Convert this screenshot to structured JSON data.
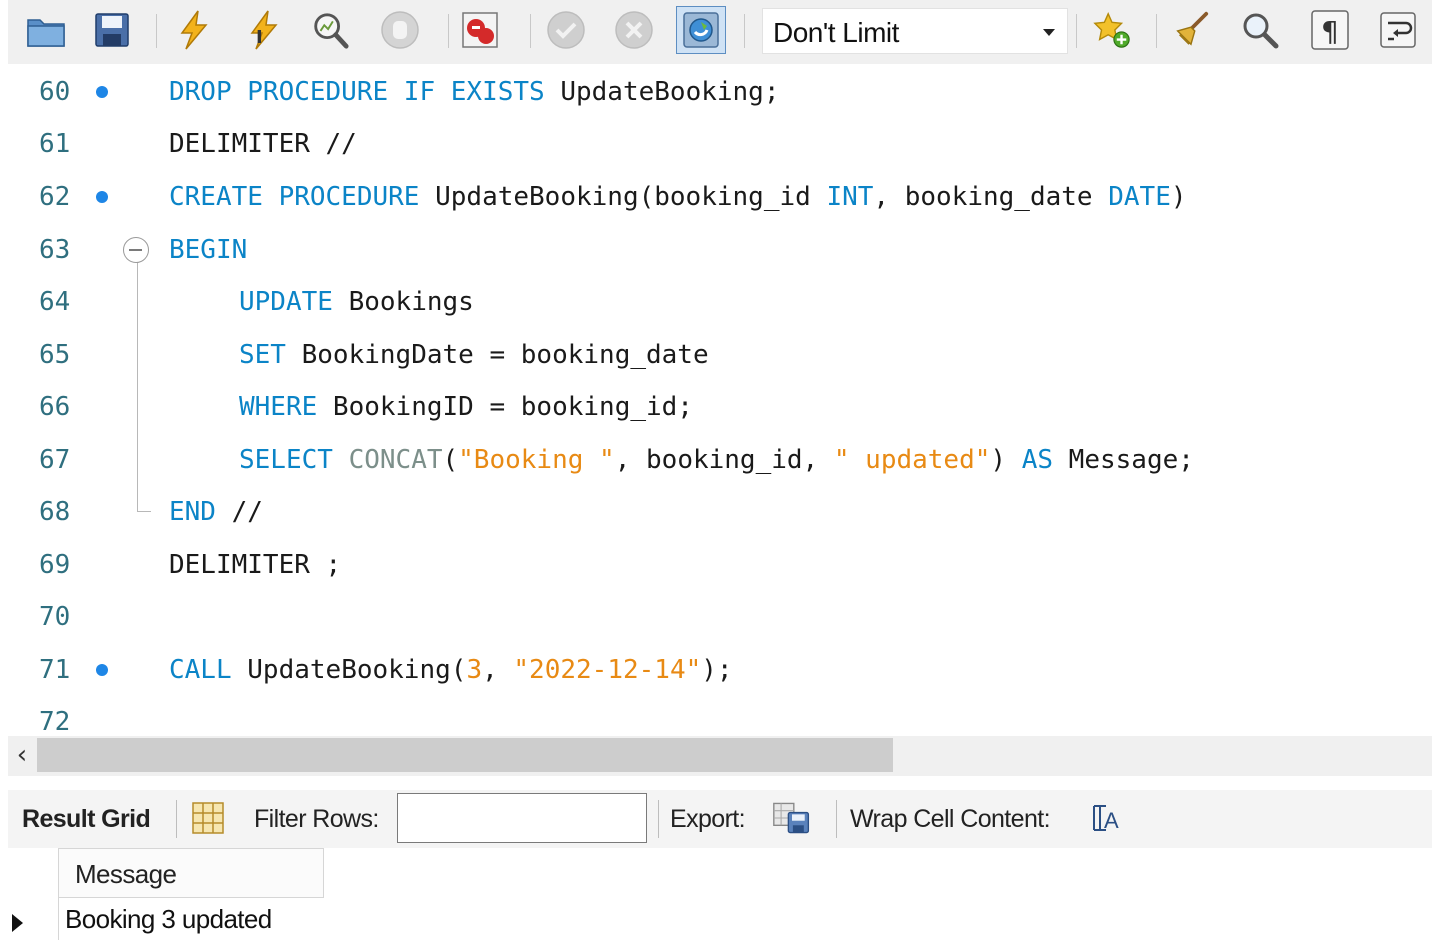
{
  "toolbar": {
    "limit_select": "Don't Limit"
  },
  "editor": {
    "lines": [
      {
        "num": "60",
        "dot": true
      },
      {
        "num": "61",
        "dot": false
      },
      {
        "num": "62",
        "dot": true
      },
      {
        "num": "63",
        "dot": false
      },
      {
        "num": "64",
        "dot": false
      },
      {
        "num": "65",
        "dot": false
      },
      {
        "num": "66",
        "dot": false
      },
      {
        "num": "67",
        "dot": false
      },
      {
        "num": "68",
        "dot": false
      },
      {
        "num": "69",
        "dot": false
      },
      {
        "num": "70",
        "dot": false
      },
      {
        "num": "71",
        "dot": true
      },
      {
        "num": "72",
        "dot": false
      }
    ],
    "code": {
      "l60": [
        {
          "t": "DROP PROCEDURE IF EXISTS",
          "c": "kw"
        },
        {
          "t": " UpdateBooking;",
          "c": ""
        }
      ],
      "l61": [
        {
          "t": "DELIMITER //",
          "c": ""
        }
      ],
      "l62": [
        {
          "t": "CREATE PROCEDURE",
          "c": "kw"
        },
        {
          "t": " UpdateBooking(booking_id ",
          "c": ""
        },
        {
          "t": "INT",
          "c": "kw"
        },
        {
          "t": ", booking_date ",
          "c": ""
        },
        {
          "t": "DATE",
          "c": "kw"
        },
        {
          "t": ")",
          "c": ""
        }
      ],
      "l63": [
        {
          "t": "BEGIN",
          "c": "kw"
        }
      ],
      "l64": [
        {
          "t": "UPDATE",
          "c": "kw"
        },
        {
          "t": " Bookings",
          "c": ""
        }
      ],
      "l65": [
        {
          "t": "SET",
          "c": "kw"
        },
        {
          "t": " BookingDate = booking_date",
          "c": ""
        }
      ],
      "l66": [
        {
          "t": "WHERE",
          "c": "kw"
        },
        {
          "t": " BookingID = booking_id;",
          "c": ""
        }
      ],
      "l67": [
        {
          "t": "SELECT",
          "c": "kw"
        },
        {
          "t": " ",
          "c": ""
        },
        {
          "t": "CONCAT",
          "c": "fn"
        },
        {
          "t": "(",
          "c": ""
        },
        {
          "t": "\"Booking \"",
          "c": "str"
        },
        {
          "t": ", booking_id, ",
          "c": ""
        },
        {
          "t": "\" updated\"",
          "c": "str"
        },
        {
          "t": ") ",
          "c": ""
        },
        {
          "t": "AS",
          "c": "kw"
        },
        {
          "t": " Message;",
          "c": ""
        }
      ],
      "l68": [
        {
          "t": "END",
          "c": "kw"
        },
        {
          "t": " //",
          "c": ""
        }
      ],
      "l69": [
        {
          "t": "DELIMITER ;",
          "c": ""
        }
      ],
      "l70": [],
      "l71": [
        {
          "t": "CALL",
          "c": "kw"
        },
        {
          "t": " UpdateBooking(",
          "c": ""
        },
        {
          "t": "3",
          "c": "num"
        },
        {
          "t": ", ",
          "c": ""
        },
        {
          "t": "\"2022-12-14\"",
          "c": "str"
        },
        {
          "t": ");",
          "c": ""
        }
      ],
      "l72": []
    }
  },
  "results": {
    "tab_label": "Result Grid",
    "filter_label": "Filter Rows:",
    "filter_value": "",
    "export_label": "Export:",
    "wrap_label": "Wrap Cell Content:",
    "column_header": "Message",
    "row_value": "Booking 3 updated"
  },
  "colors": {
    "keyword": "#0b84c7",
    "string": "#e88a14",
    "function": "#7c8f8a",
    "line_number": "#2f6f7f",
    "breakpoint_dot": "#1e86e6"
  }
}
